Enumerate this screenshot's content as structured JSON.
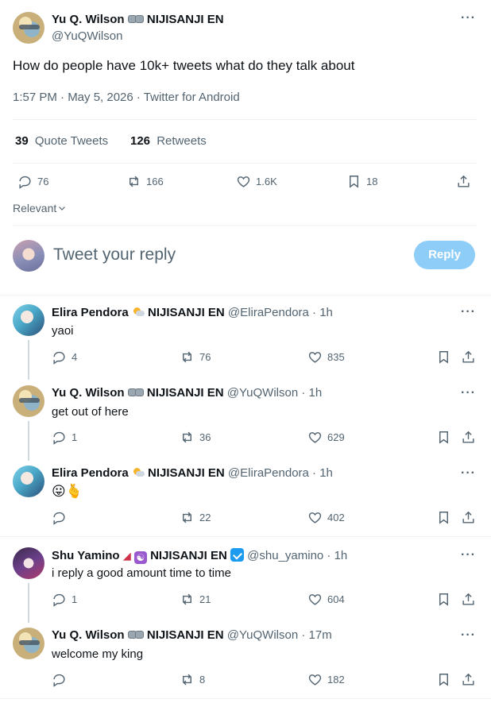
{
  "main_tweet": {
    "author_name": "Yu Q. Wilson",
    "author_affiliation": "NIJISANJI EN",
    "author_handle": "@YuQWilson",
    "text": "How do people have 10k+ tweets what do they talk about",
    "meta": "1:57 PM · May 5, 2026 · Twitter for Android",
    "quote_count": "39",
    "quote_label": "Quote Tweets",
    "retweet_count": "126",
    "retweet_label": "Retweets",
    "actions": {
      "replies": "76",
      "retweets": "166",
      "likes": "1.6K",
      "bookmarks": "18"
    }
  },
  "sort": {
    "label": "Relevant"
  },
  "composer": {
    "placeholder": "Tweet your reply",
    "button": "Reply"
  },
  "replies": [
    {
      "name": "Elira Pendora",
      "affiliation": "NIJISANJI EN",
      "handle": "@EliraPendora",
      "time": "1h",
      "text": "yaoi",
      "replies": "4",
      "retweets": "76",
      "likes": "835",
      "emoji_text": ""
    },
    {
      "name": "Yu Q. Wilson",
      "affiliation": "NIJISANJI EN",
      "handle": "@YuQWilson",
      "time": "1h",
      "text": "get out of here",
      "replies": "1",
      "retweets": "36",
      "likes": "629",
      "emoji_text": ""
    },
    {
      "name": "Elira Pendora",
      "affiliation": "NIJISANJI EN",
      "handle": "@EliraPendora",
      "time": "1h",
      "text": "😛🫰",
      "replies": "",
      "retweets": "22",
      "likes": "402",
      "emoji_text": ""
    },
    {
      "name": "Shu Yamino",
      "affiliation": "NIJISANJI EN",
      "handle": "@shu_yamino",
      "time": "1h",
      "text": "i reply a good amount time to time",
      "replies": "1",
      "retweets": "21",
      "likes": "604",
      "emoji_text": ""
    },
    {
      "name": "Yu Q. Wilson",
      "affiliation": "NIJISANJI EN",
      "handle": "@YuQWilson",
      "time": "17m",
      "text": "welcome my king",
      "replies": "",
      "retweets": "8",
      "likes": "182",
      "emoji_text": ""
    }
  ],
  "separator": " · ",
  "icons": {
    "reply": "reply-icon",
    "retweet": "retweet-icon",
    "like": "heart-icon",
    "bookmark": "bookmark-icon",
    "share": "share-icon",
    "more": "more-icon",
    "chevron": "chevron-down-icon"
  },
  "colors": {
    "accent": "#1d9bf0",
    "text": "#0f1419",
    "muted": "#536471",
    "border": "#eff3f4",
    "reply_button_bg": "#8ecdf8"
  }
}
